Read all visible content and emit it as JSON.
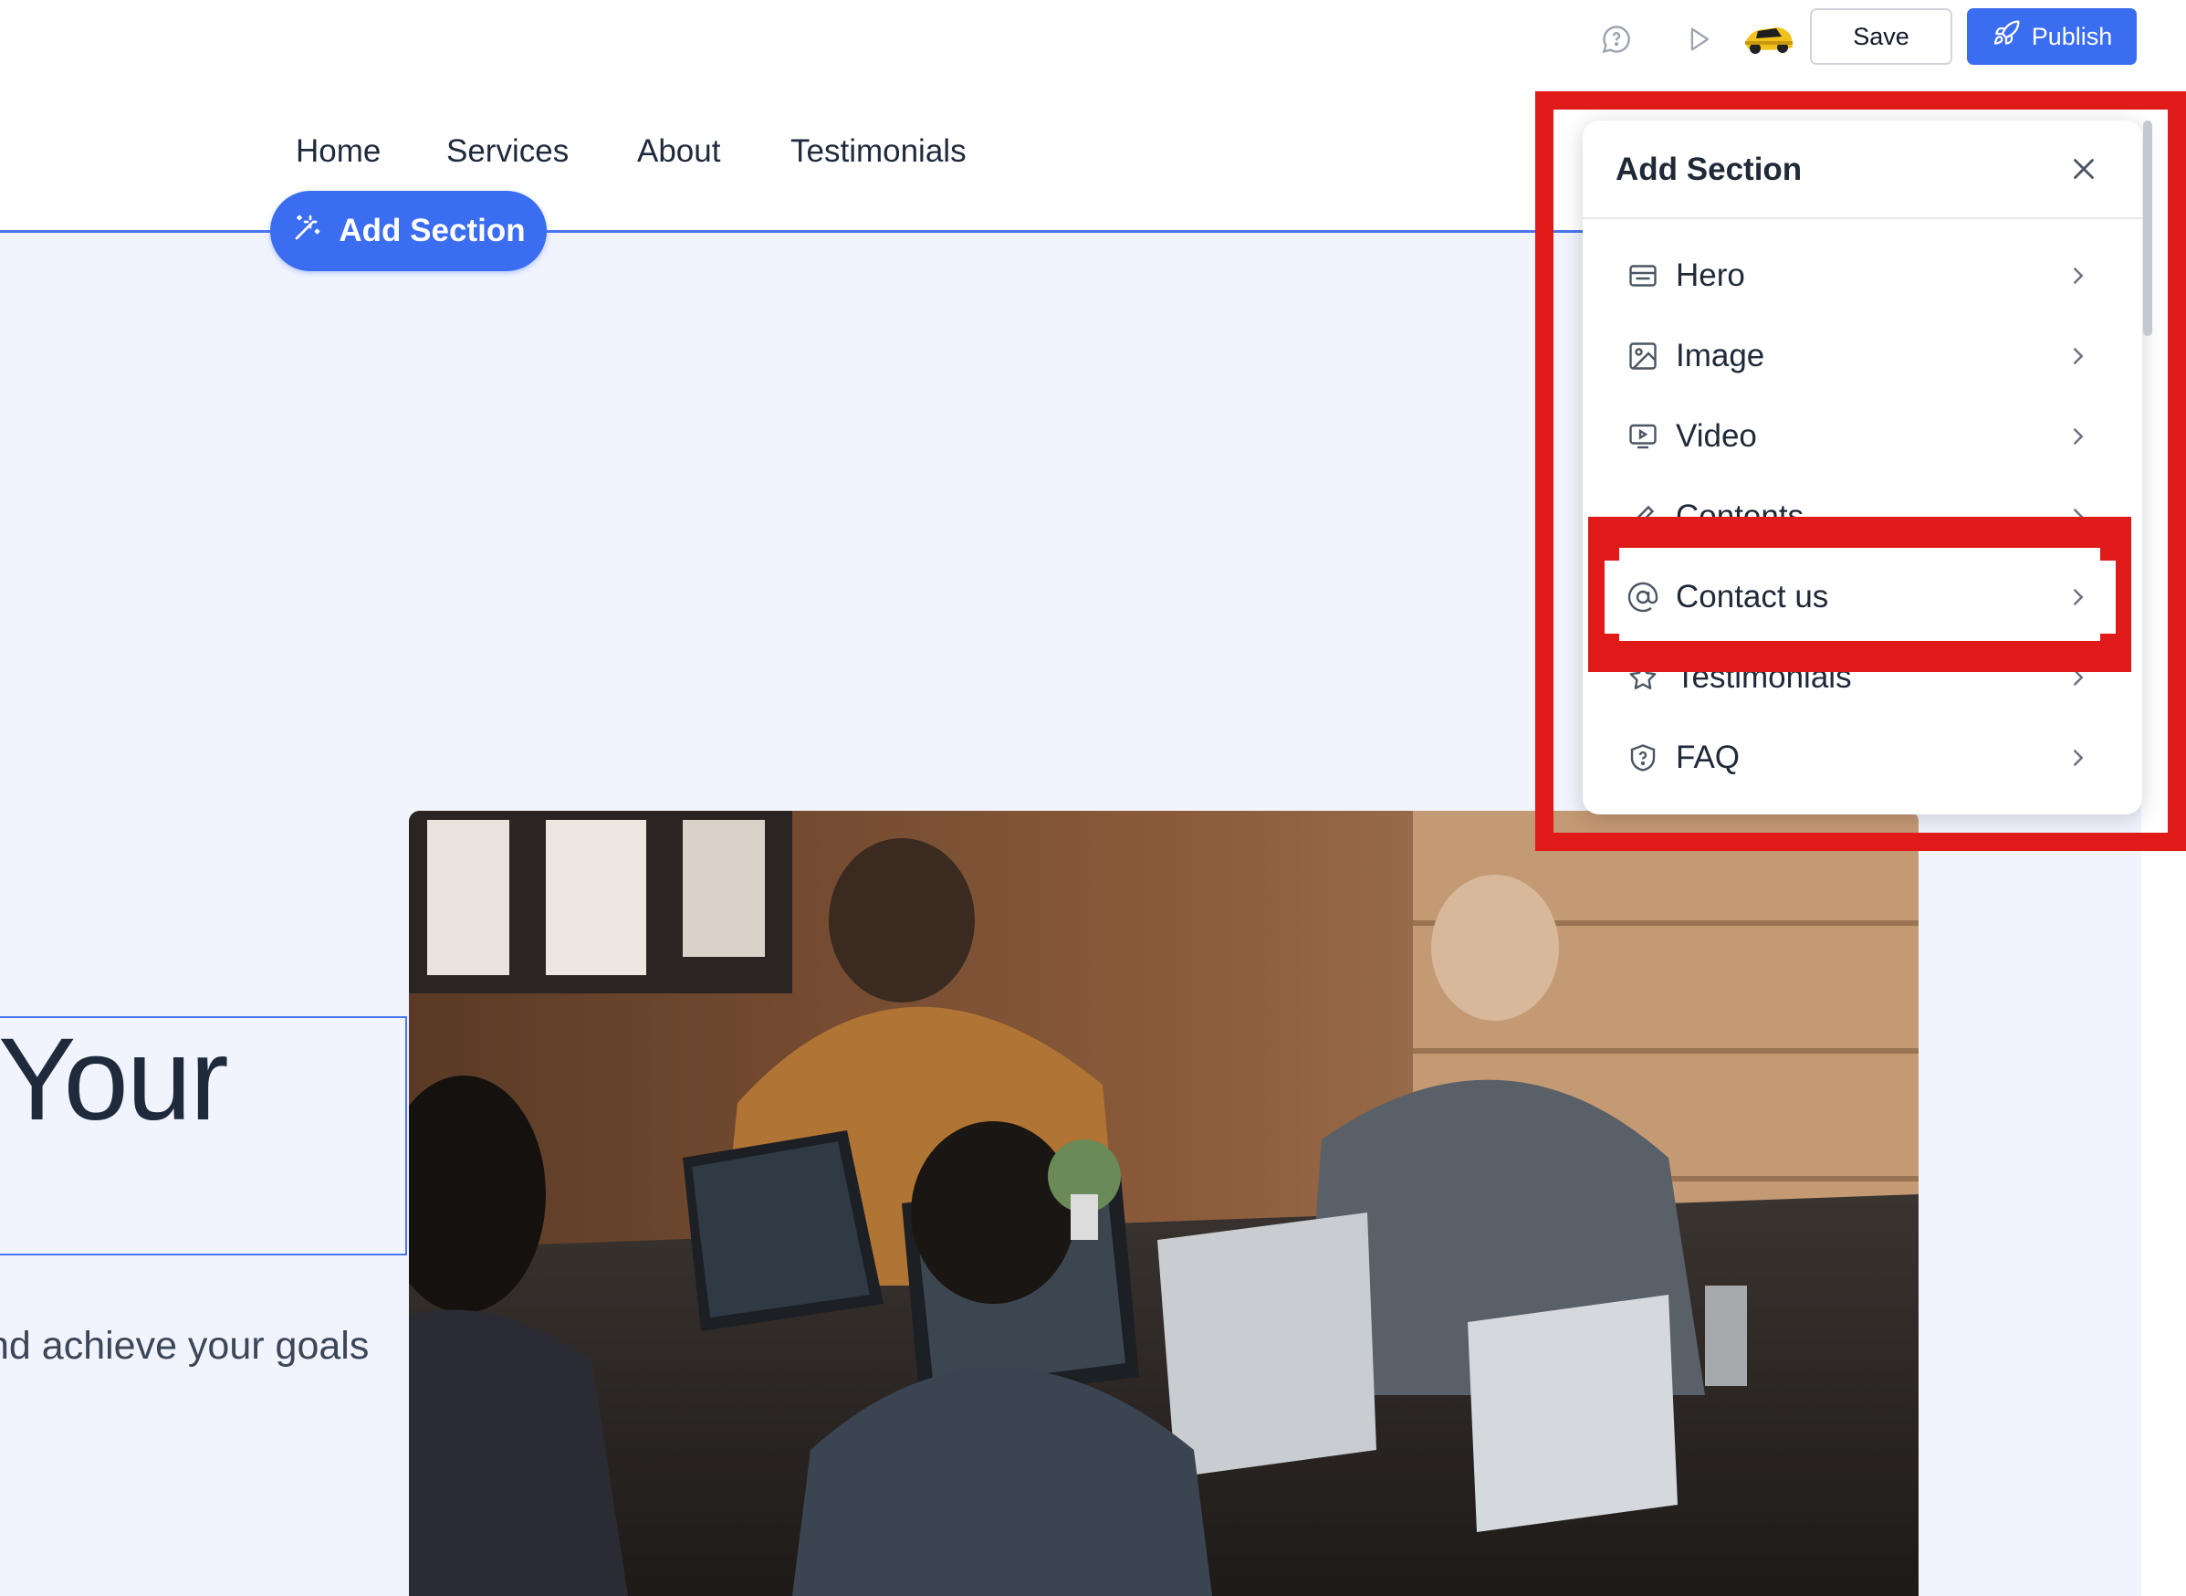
{
  "toolbar": {
    "save_label": "Save",
    "publish_label": "Publish",
    "icons": [
      "chat-icon",
      "preview-play-icon",
      "avatar",
      "rocket-icon"
    ]
  },
  "site_nav": {
    "links": [
      "Home",
      "Services",
      "About",
      "Testimonials"
    ],
    "add_section_label": "Add Section"
  },
  "hero": {
    "title_fragment": "Your",
    "subtitle_fragment": "nd achieve your goals"
  },
  "panel": {
    "title": "Add Section",
    "items": [
      {
        "label": "Hero",
        "icon": "hero-icon"
      },
      {
        "label": "Image",
        "icon": "image-icon"
      },
      {
        "label": "Video",
        "icon": "video-icon"
      },
      {
        "label": "Contents",
        "icon": "pencil-icon"
      },
      {
        "label": "Contact us",
        "icon": "at-icon"
      },
      {
        "label": "Testimonials",
        "icon": "star-icon"
      },
      {
        "label": "FAQ",
        "icon": "shield-question-icon"
      }
    ]
  },
  "colors": {
    "accent": "#3b6df0",
    "canvas_bg": "#f1f4fd",
    "annotation": "#e01919"
  }
}
